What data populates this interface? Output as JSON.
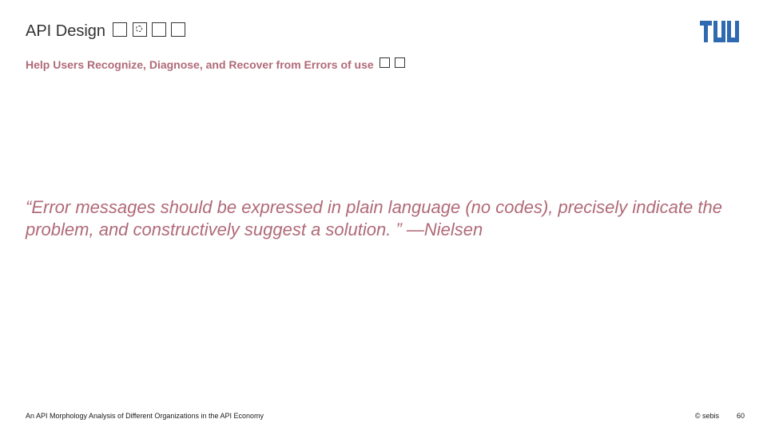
{
  "header": {
    "title": "API Design"
  },
  "subtitle": {
    "text": "Help Users Recognize, Diagnose, and Recover from Errors of use"
  },
  "quote": {
    "text": "“Error messages should be expressed in plain language (no codes), precisely indicate the problem, and constructively suggest a solution. ” —Nielsen"
  },
  "footer": {
    "left": "An API Morphology Analysis of Different Organizations in the API Economy",
    "copyright": "© sebis",
    "page": "60"
  },
  "colors": {
    "accent": "#b06a78",
    "brand": "#2f6ab1"
  }
}
